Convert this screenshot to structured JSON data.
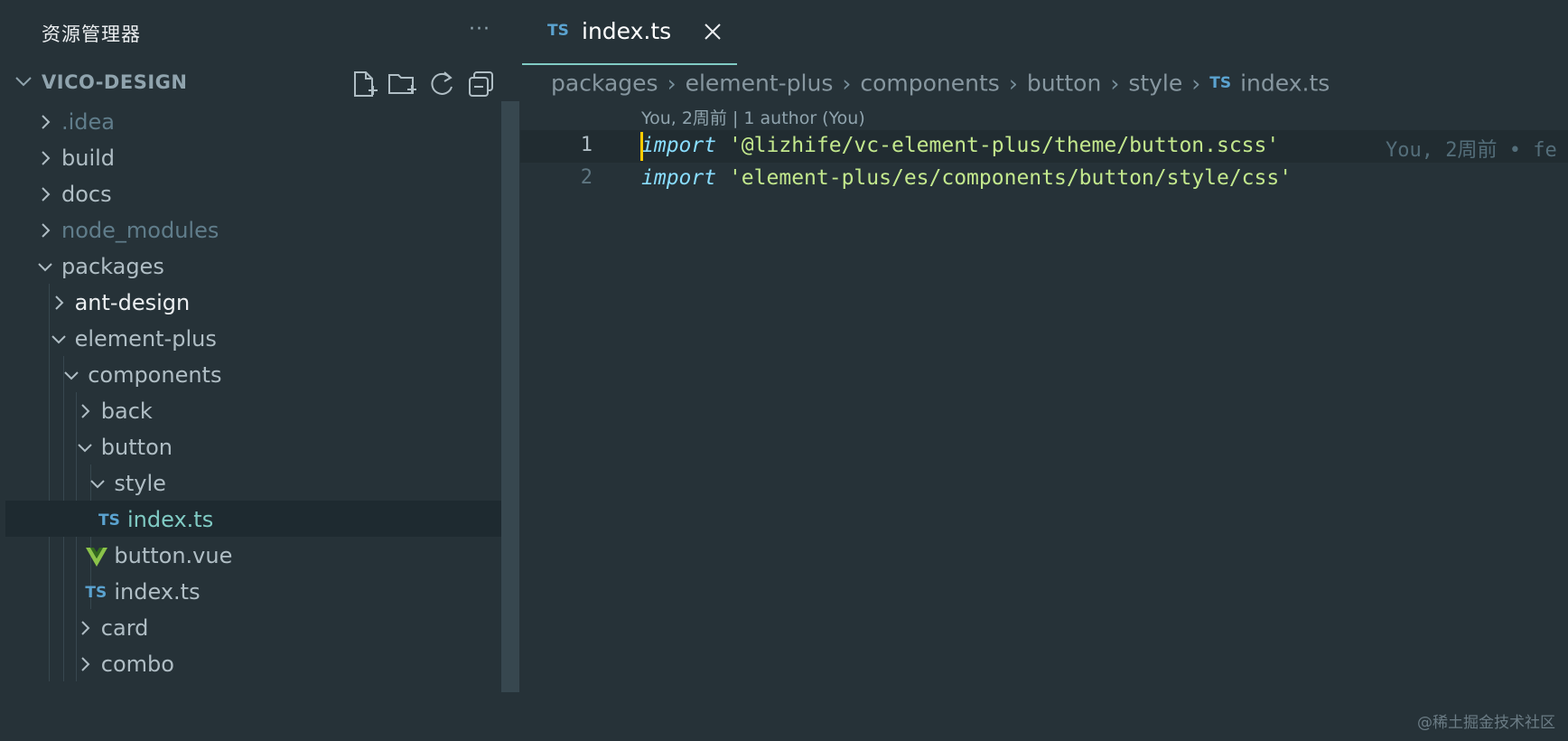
{
  "explorer": {
    "title": "资源管理器",
    "more_label": "···",
    "root": "VICO-DESIGN",
    "actions": [
      "new-file-icon",
      "new-folder-icon",
      "refresh-icon",
      "collapse-all-icon"
    ]
  },
  "tree": [
    {
      "label": ".idea",
      "type": "folder",
      "expanded": false,
      "depth": 0,
      "dim": true
    },
    {
      "label": "build",
      "type": "folder",
      "expanded": false,
      "depth": 0
    },
    {
      "label": "docs",
      "type": "folder",
      "expanded": false,
      "depth": 0
    },
    {
      "label": "node_modules",
      "type": "folder",
      "expanded": false,
      "depth": 0,
      "dim": true
    },
    {
      "label": "packages",
      "type": "folder",
      "expanded": true,
      "depth": 0
    },
    {
      "label": "ant-design",
      "type": "folder",
      "expanded": false,
      "depth": 1,
      "bright": true
    },
    {
      "label": "element-plus",
      "type": "folder",
      "expanded": true,
      "depth": 1
    },
    {
      "label": "components",
      "type": "folder",
      "expanded": true,
      "depth": 2
    },
    {
      "label": "back",
      "type": "folder",
      "expanded": false,
      "depth": 3
    },
    {
      "label": "button",
      "type": "folder",
      "expanded": true,
      "depth": 3
    },
    {
      "label": "style",
      "type": "folder",
      "expanded": true,
      "depth": 4
    },
    {
      "label": "index.ts",
      "type": "ts",
      "depth": 5,
      "selected": true,
      "icon_text": "TS"
    },
    {
      "label": "button.vue",
      "type": "vue",
      "depth": 4
    },
    {
      "label": "index.ts",
      "type": "ts",
      "depth": 4,
      "icon_text": "TS"
    },
    {
      "label": "card",
      "type": "folder",
      "expanded": false,
      "depth": 3
    },
    {
      "label": "combo",
      "type": "folder",
      "expanded": false,
      "depth": 3
    }
  ],
  "editor": {
    "tab": {
      "icon_text": "TS",
      "name": "index.ts"
    },
    "breadcrumb": [
      "packages",
      "element-plus",
      "components",
      "button",
      "style"
    ],
    "breadcrumb_file": {
      "icon_text": "TS",
      "name": "index.ts"
    },
    "codelens": "You, 2周前 | 1 author (You)",
    "lines": [
      {
        "number": "1",
        "keyword": "import",
        "string": "'@lizhife/vc-element-plus/theme/button.scss'",
        "blame": "You, 2周前 • fe"
      },
      {
        "number": "2",
        "keyword": "import",
        "string": "'element-plus/es/components/button/style/css'",
        "blame": ""
      }
    ]
  },
  "watermark": "@稀土掘金技术社区",
  "colors": {
    "background": "#263238",
    "tab_accent": "#80cbc4",
    "ts_icon": "#5ba3d0",
    "keyword": "#89ddff",
    "string": "#c3e88d",
    "cursor": "#ffcc00"
  }
}
